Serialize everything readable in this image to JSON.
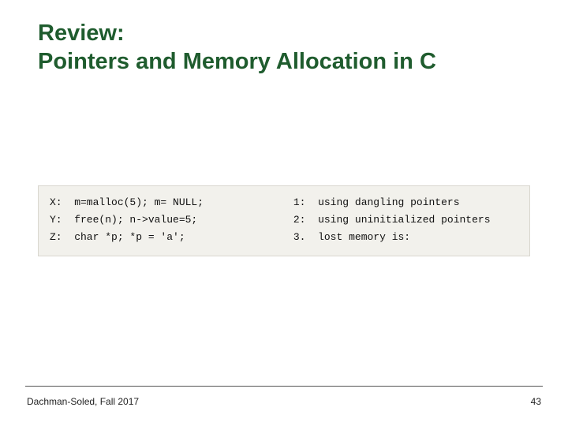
{
  "title": {
    "line1": "Review:",
    "line2": "Pointers and Memory Allocation in C"
  },
  "code": {
    "left": {
      "x": "X:  m=malloc(5); m= NULL;",
      "y": "Y:  free(n); n->value=5;",
      "z": "Z:  char *p; *p = 'a';"
    },
    "right": {
      "r1": "1:  using dangling pointers",
      "r2": "2:  using uninitialized pointers",
      "r3": "3.  lost memory is:"
    }
  },
  "footer": {
    "author": "Dachman-Soled, Fall 2017",
    "page": "43"
  }
}
